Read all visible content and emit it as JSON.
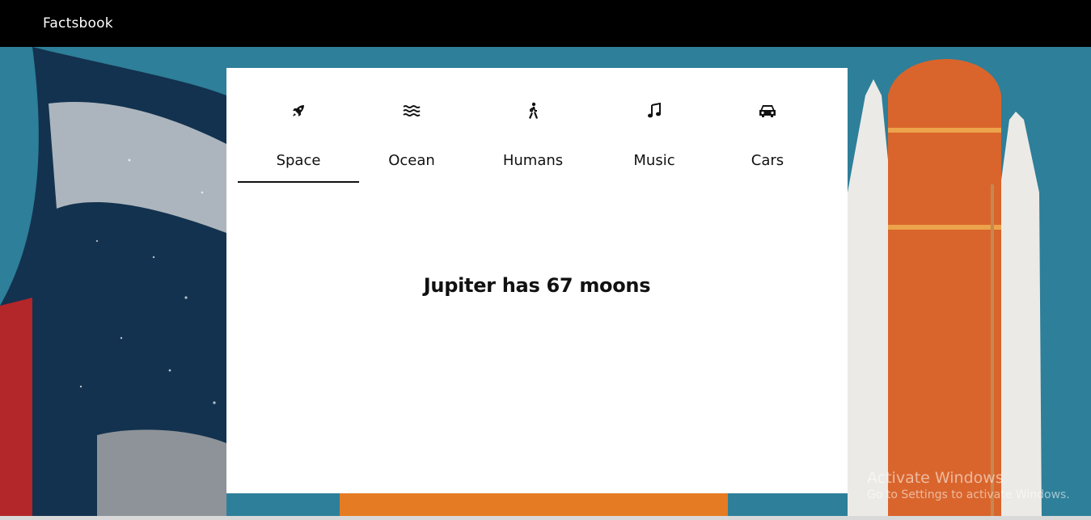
{
  "navbar": {
    "brand": "Factsbook"
  },
  "tabs": [
    {
      "label": "Space",
      "icon": "rocket-icon",
      "active": true
    },
    {
      "label": "Ocean",
      "icon": "water-waves-icon",
      "active": false
    },
    {
      "label": "Humans",
      "icon": "walking-person-icon",
      "active": false
    },
    {
      "label": "Music",
      "icon": "music-note-icon",
      "active": false
    },
    {
      "label": "Cars",
      "icon": "car-icon",
      "active": false
    }
  ],
  "fact": {
    "text": "Jupiter has 67 moons"
  },
  "watermark": {
    "title": "Activate Windows",
    "subtitle": "Go to Settings to activate Windows."
  },
  "colors": {
    "navbar": "#000000",
    "card": "#ffffff",
    "text": "#111111"
  }
}
